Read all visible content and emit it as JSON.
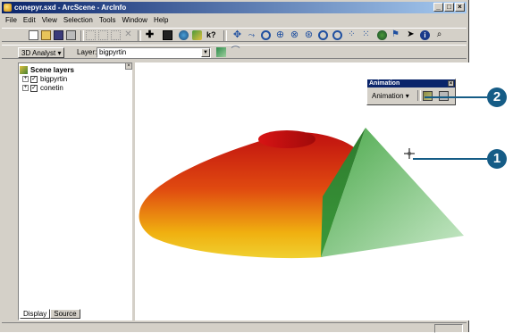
{
  "window": {
    "title": "conepyr.sxd - ArcScene - ArcInfo",
    "buttons": [
      "_",
      "□",
      "×"
    ]
  },
  "menu": [
    "File",
    "Edit",
    "View",
    "Selection",
    "Tools",
    "Window",
    "Help"
  ],
  "toolbar_icons": [
    "new-icon",
    "open-icon",
    "save-icon",
    "print-icon",
    "cut-icon",
    "copy-icon",
    "paste-icon",
    "delete-icon",
    "add-data-icon",
    "scene-properties-icon",
    "globe-icon",
    "arcmap-icon",
    "whats-this-icon",
    "navigate-icon",
    "fly-icon",
    "zoom-in-out-icon",
    "target-center-icon",
    "zoom-to-target-icon",
    "set-observer-icon",
    "zoom-in-icon",
    "zoom-out-icon",
    "pan-icon",
    "full-extent-icon",
    "select-features-icon",
    "identify-icon",
    "info-icon",
    "find-icon"
  ],
  "analyst": {
    "dropdown_label": "3D Analyst ▾",
    "layer_label": "Layer:",
    "layer_value": "bigpyrtin"
  },
  "toc": {
    "root": "Scene layers",
    "layers": [
      {
        "name": "bigpyrtin",
        "checked": true
      },
      {
        "name": "conetin",
        "checked": true
      }
    ],
    "tabs": [
      "Display",
      "Source"
    ]
  },
  "animation_toolbar": {
    "title": "Animation",
    "menu_label": "Animation ▾",
    "close": "×"
  },
  "callouts": [
    "2",
    "1"
  ]
}
